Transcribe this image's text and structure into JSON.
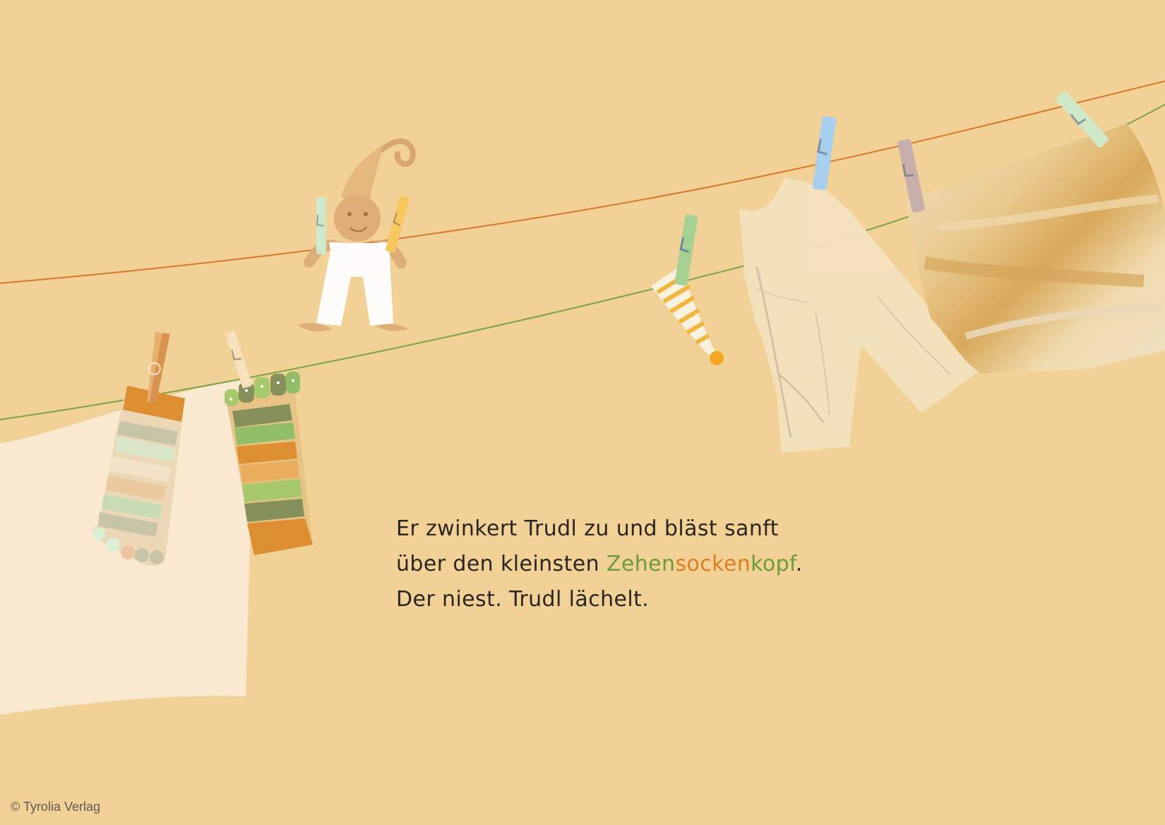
{
  "story": {
    "line1": "Er zwinkert Trudl zu und bläst sanft",
    "line2_prefix": "über den kleinsten ",
    "word_part_1": "Zehen",
    "word_part_2": "socken",
    "word_part_3": "kopf",
    "line2_suffix": ".",
    "line3": "Der niest. Trudl lächelt."
  },
  "footer": {
    "copyright": "© Tyrolia Verlag"
  },
  "colors": {
    "background": "#f2d196",
    "text": "#2b2622",
    "accent_green": "#6c9b38",
    "accent_orange": "#df7c26"
  },
  "illustration": {
    "icons": [
      "clothesline",
      "clothespin",
      "sock",
      "toe-sock",
      "sleep-cap",
      "overall",
      "fabric-cloth",
      "child-character"
    ]
  }
}
